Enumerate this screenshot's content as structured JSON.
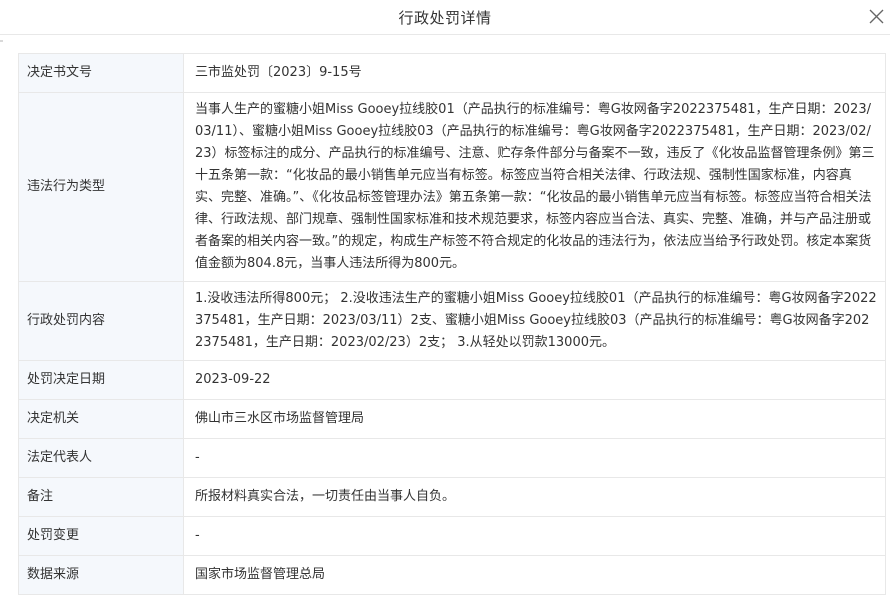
{
  "dialog": {
    "title": "行政处罚详情",
    "close_icon": "close-icon"
  },
  "rows": [
    {
      "label": "决定书文号",
      "value": "三市监处罚〔2023〕9-15号"
    },
    {
      "label": "违法行为类型",
      "value": "当事人生产的蜜糖小姐Miss Gooey拉线胶01（产品执行的标准编号：粤G妆网备字2022375481，生产日期：2023/03/11）、蜜糖小姐Miss Gooey拉线胶03（产品执行的标准编号：粤G妆网备字2022375481，生产日期：2023/02/23）标签标注的成分、产品执行的标准编号、注意、贮存条件部分与备案不一致，违反了《化妆品监督管理条例》第三十五条第一款：“化妆品的最小销售单元应当有标签。标签应当符合相关法律、行政法规、强制性国家标准，内容真实、完整、准确。”、《化妆品标签管理办法》第五条第一款：“化妆品的最小销售单元应当有标签。标签应当符合相关法律、行政法规、部门规章、强制性国家标准和技术规范要求，标签内容应当合法、真实、完整、准确，并与产品注册或者备案的相关内容一致。”的规定，构成生产标签不符合规定的化妆品的违法行为，依法应当给予行政处罚。核定本案货值金额为804.8元，当事人违法所得为800元。"
    },
    {
      "label": "行政处罚内容",
      "value": "1.没收违法所得800元； 2.没收违法生产的蜜糖小姐Miss Gooey拉线胶01（产品执行的标准编号：粤G妆网备字2022375481，生产日期：2023/03/11）2支、蜜糖小姐Miss Gooey拉线胶03（产品执行的标准编号：粤G妆网备字2022375481，生产日期：2023/02/23）2支； 3.从轻处以罚款13000元。"
    },
    {
      "label": "处罚决定日期",
      "value": "2023-09-22"
    },
    {
      "label": "决定机关",
      "value": "佛山市三水区市场监督管理局"
    },
    {
      "label": "法定代表人",
      "value": "-"
    },
    {
      "label": "备注",
      "value": "所报材料真实合法，一切责任由当事人自负。"
    },
    {
      "label": "处罚变更",
      "value": "-"
    },
    {
      "label": "数据来源",
      "value": "国家市场监督管理总局"
    }
  ],
  "colors": {
    "label_bg": "#f5f8fc",
    "border": "#e8e8e8",
    "text": "#333333"
  }
}
